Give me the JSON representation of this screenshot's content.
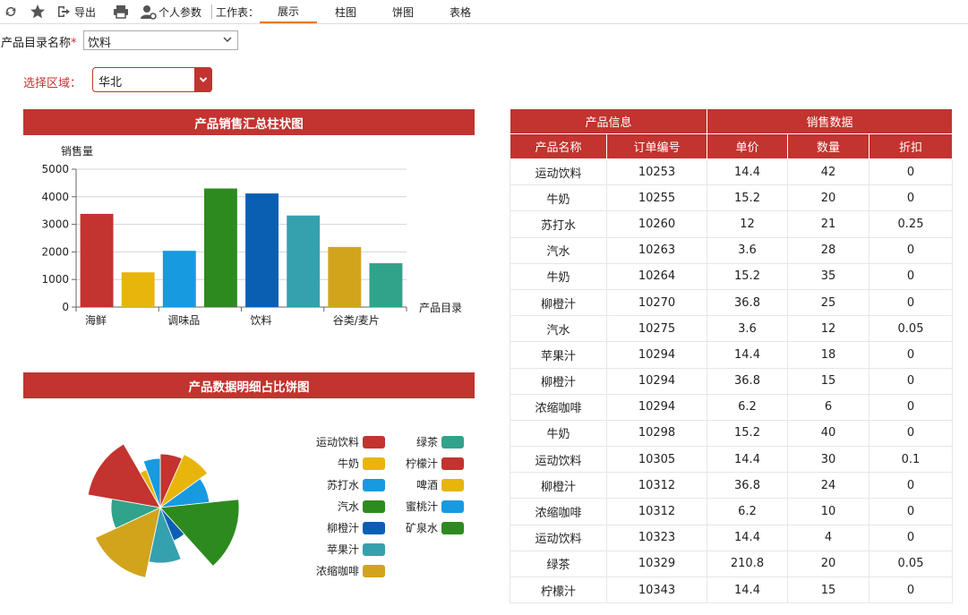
{
  "toolbar": {
    "export_label": "导出",
    "params_label": "个人参数",
    "sheet_label": "工作表：",
    "tabs": [
      "展示",
      "柱图",
      "饼图",
      "表格"
    ],
    "active_tab": 0,
    "accent": "#e57b1a"
  },
  "form": {
    "catalog_label": "产品目录名称",
    "required_mark": "*",
    "catalog_value": "饮料",
    "region_label": "选择区域：",
    "region_value": "华北"
  },
  "bar_panel": {
    "title": "产品销售汇总柱状图"
  },
  "pie_panel": {
    "title": "产品数据明细占比饼图"
  },
  "chart_data": [
    {
      "type": "bar",
      "ylabel": "销售量",
      "xlabel": "产品目录",
      "ylim": [
        0,
        5000
      ],
      "yticks": [
        0,
        1000,
        2000,
        3000,
        4000,
        5000
      ],
      "grid": true,
      "x_tick_labels": [
        "海鲜",
        "调味品",
        "饮料",
        "谷类/麦片"
      ],
      "values": [
        3380,
        1260,
        2040,
        4300,
        4120,
        3320,
        2180,
        1590
      ],
      "colors": [
        "#c3332f",
        "#e8b50c",
        "#179ae0",
        "#2d8a1f",
        "#0a5fb3",
        "#35a0ae",
        "#d1a41c",
        "#30a38a"
      ]
    },
    {
      "type": "pie",
      "legend": [
        {
          "name": "运动饮料",
          "color": "#c3332f"
        },
        {
          "name": "牛奶",
          "color": "#e8b50c"
        },
        {
          "name": "苏打水",
          "color": "#179ae0"
        },
        {
          "name": "汽水",
          "color": "#2d8a1f"
        },
        {
          "name": "柳橙汁",
          "color": "#0a5fb3"
        },
        {
          "name": "苹果汁",
          "color": "#35a0ae"
        },
        {
          "name": "浓缩咖啡",
          "color": "#d1a41c"
        },
        {
          "name": "绿茶",
          "color": "#30a38a"
        },
        {
          "name": "柠檬汁",
          "color": "#c3332f"
        },
        {
          "name": "啤酒",
          "color": "#e8b50c"
        },
        {
          "name": "蜜桃汁",
          "color": "#179ae0"
        },
        {
          "name": "矿泉水",
          "color": "#2d8a1f"
        }
      ],
      "slices": [
        {
          "color": "#c3332f",
          "start": -90,
          "end": -66,
          "r": 60
        },
        {
          "color": "#e8b50c",
          "start": -66,
          "end": -36,
          "r": 65
        },
        {
          "color": "#179ae0",
          "start": -36,
          "end": -6,
          "r": 55
        },
        {
          "color": "#2d8a1f",
          "start": -6,
          "end": 48,
          "r": 88
        },
        {
          "color": "#0a5fb3",
          "start": 48,
          "end": 68,
          "r": 40
        },
        {
          "color": "#35a0ae",
          "start": 68,
          "end": 102,
          "r": 62
        },
        {
          "color": "#d1a41c",
          "start": 102,
          "end": 155,
          "r": 80
        },
        {
          "color": "#30a38a",
          "start": 155,
          "end": 190,
          "r": 55
        },
        {
          "color": "#c3332f",
          "start": 190,
          "end": 240,
          "r": 82
        },
        {
          "color": "#e8b50c",
          "start": 240,
          "end": 250,
          "r": 45
        },
        {
          "color": "#179ae0",
          "start": 250,
          "end": 270,
          "r": 55
        }
      ]
    }
  ],
  "table": {
    "group_headers": [
      "产品信息",
      "销售数据"
    ],
    "columns": [
      "产品名称",
      "订单编号",
      "单价",
      "数量",
      "折扣"
    ],
    "rows": [
      [
        "运动饮料",
        "10253",
        "14.4",
        "42",
        "0"
      ],
      [
        "牛奶",
        "10255",
        "15.2",
        "20",
        "0"
      ],
      [
        "苏打水",
        "10260",
        "12",
        "21",
        "0.25"
      ],
      [
        "汽水",
        "10263",
        "3.6",
        "28",
        "0"
      ],
      [
        "牛奶",
        "10264",
        "15.2",
        "35",
        "0"
      ],
      [
        "柳橙汁",
        "10270",
        "36.8",
        "25",
        "0"
      ],
      [
        "汽水",
        "10275",
        "3.6",
        "12",
        "0.05"
      ],
      [
        "苹果汁",
        "10294",
        "14.4",
        "18",
        "0"
      ],
      [
        "柳橙汁",
        "10294",
        "36.8",
        "15",
        "0"
      ],
      [
        "浓缩咖啡",
        "10294",
        "6.2",
        "6",
        "0"
      ],
      [
        "牛奶",
        "10298",
        "15.2",
        "40",
        "0"
      ],
      [
        "运动饮料",
        "10305",
        "14.4",
        "30",
        "0.1"
      ],
      [
        "柳橙汁",
        "10312",
        "36.8",
        "24",
        "0"
      ],
      [
        "浓缩咖啡",
        "10312",
        "6.2",
        "10",
        "0"
      ],
      [
        "运动饮料",
        "10323",
        "14.4",
        "4",
        "0"
      ],
      [
        "绿茶",
        "10329",
        "210.8",
        "20",
        "0.05"
      ],
      [
        "柠檬汁",
        "10343",
        "14.4",
        "15",
        "0"
      ]
    ]
  }
}
